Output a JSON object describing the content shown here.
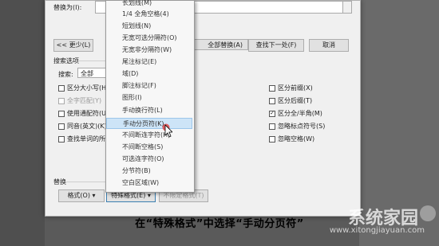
{
  "dialog": {
    "replace_with_label": "替换为(I):",
    "less_button": "<< 更少(L)",
    "replace_all_button": "全部替换(A)",
    "find_next_button": "查找下一处(F)",
    "cancel_button": "取消",
    "search_options_label": "搜索选项",
    "search_label": "搜索:",
    "search_value": "全部",
    "left_options": [
      {
        "label": "区分大小写(H)",
        "checked": false,
        "disabled": false
      },
      {
        "label": "全字匹配(Y)",
        "checked": false,
        "disabled": true
      },
      {
        "label": "使用通配符(U)",
        "checked": false,
        "disabled": false
      },
      {
        "label": "同音(英文)(K)",
        "checked": false,
        "disabled": false
      },
      {
        "label": "查找单词的所",
        "checked": false,
        "disabled": false
      }
    ],
    "right_options": [
      {
        "label": "区分前缀(X)",
        "checked": false
      },
      {
        "label": "区分后缀(T)",
        "checked": false
      },
      {
        "label": "区分全/半角(M)",
        "checked": true
      },
      {
        "label": "忽略标点符号(S)",
        "checked": false
      },
      {
        "label": "忽略空格(W)",
        "checked": false
      }
    ],
    "replace_section_label": "替换",
    "format_button": "格式(O) ▾",
    "special_format_button": "特殊格式(E) ▾",
    "no_format_button": "不限定格式(T)"
  },
  "menu": {
    "items": [
      {
        "label": "长划线(M)",
        "highlighted": false
      },
      {
        "label": "1/4 全角空格(4)",
        "highlighted": false
      },
      {
        "label": "短划线(N)",
        "highlighted": false
      },
      {
        "label": "无宽可选分隔符(O)",
        "highlighted": false
      },
      {
        "label": "无宽非分隔符(W)",
        "highlighted": false
      },
      {
        "label": "尾注标记(E)",
        "highlighted": false
      },
      {
        "label": "域(D)",
        "highlighted": false
      },
      {
        "label": "脚注标记(F)",
        "highlighted": false
      },
      {
        "label": "图形(I)",
        "highlighted": false
      },
      {
        "label": "手动换行符(L)",
        "highlighted": false
      },
      {
        "label": "手动分页符(K)",
        "highlighted": true
      },
      {
        "label": "不间断连字符(H)",
        "highlighted": false
      },
      {
        "label": "不间断空格(S)",
        "highlighted": false
      },
      {
        "label": "可选连字符(O)",
        "highlighted": false
      },
      {
        "label": "分节符(B)",
        "highlighted": false
      },
      {
        "label": "空白区域(W)",
        "highlighted": false
      }
    ]
  },
  "caption": "在“特殊格式”中选择“手动分页符”",
  "watermark": {
    "text": "系统家园",
    "url": "www.xitongjiayuan.com"
  },
  "colors": {
    "highlight": "#cde4f7",
    "cursor_badge": "#e04545"
  }
}
